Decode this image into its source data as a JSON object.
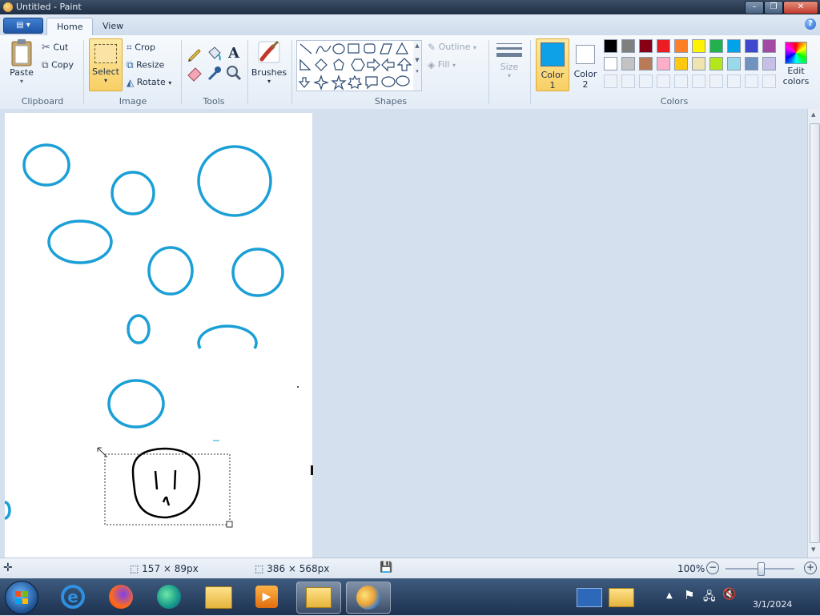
{
  "window": {
    "title": "Untitled - Paint"
  },
  "titlebar_buttons": {
    "minimize": "–",
    "maximize": "❐",
    "close": "✕"
  },
  "tabs": [
    {
      "label": "Home",
      "active": true
    },
    {
      "label": "View",
      "active": false
    }
  ],
  "app_menu": {
    "label": "▤ ▾"
  },
  "help": {
    "label": "?"
  },
  "ribbon": {
    "clipboard": {
      "paste": "Paste",
      "cut": "Cut",
      "copy": "Copy",
      "group": "Clipboard"
    },
    "image": {
      "select": "Select",
      "crop": "Crop",
      "resize": "Resize",
      "rotate": "Rotate",
      "group": "Image"
    },
    "tools": {
      "group": "Tools"
    },
    "brushes": {
      "label": "Brushes"
    },
    "shapes": {
      "outline": "Outline",
      "fill": "Fill",
      "group": "Shapes"
    },
    "size": {
      "label": "Size"
    },
    "colors": {
      "color1_label": "Color\n1",
      "color2_label": "Color\n2",
      "edit": "Edit\ncolors",
      "group": "Colors",
      "color1": "#0ea1e8",
      "color2": "#ffffff",
      "row1": [
        "#000000",
        "#7f7f7f",
        "#880015",
        "#ed1c24",
        "#ff7f27",
        "#fff200",
        "#22b14c",
        "#00a2e8",
        "#3f48cc",
        "#a349a4"
      ],
      "row2": [
        "#ffffff",
        "#c3c3c3",
        "#b97a57",
        "#ffaec9",
        "#ffc90e",
        "#efe4b0",
        "#b5e61d",
        "#99d9ea",
        "#7092be",
        "#c8bfe7"
      ]
    }
  },
  "status": {
    "selection_size": "157 × 89px",
    "canvas_size": "386 × 568px",
    "zoom": "100%"
  },
  "taskbar": {
    "clock_date": "3/1/2024"
  },
  "stroke_color": "#1a9fd6"
}
